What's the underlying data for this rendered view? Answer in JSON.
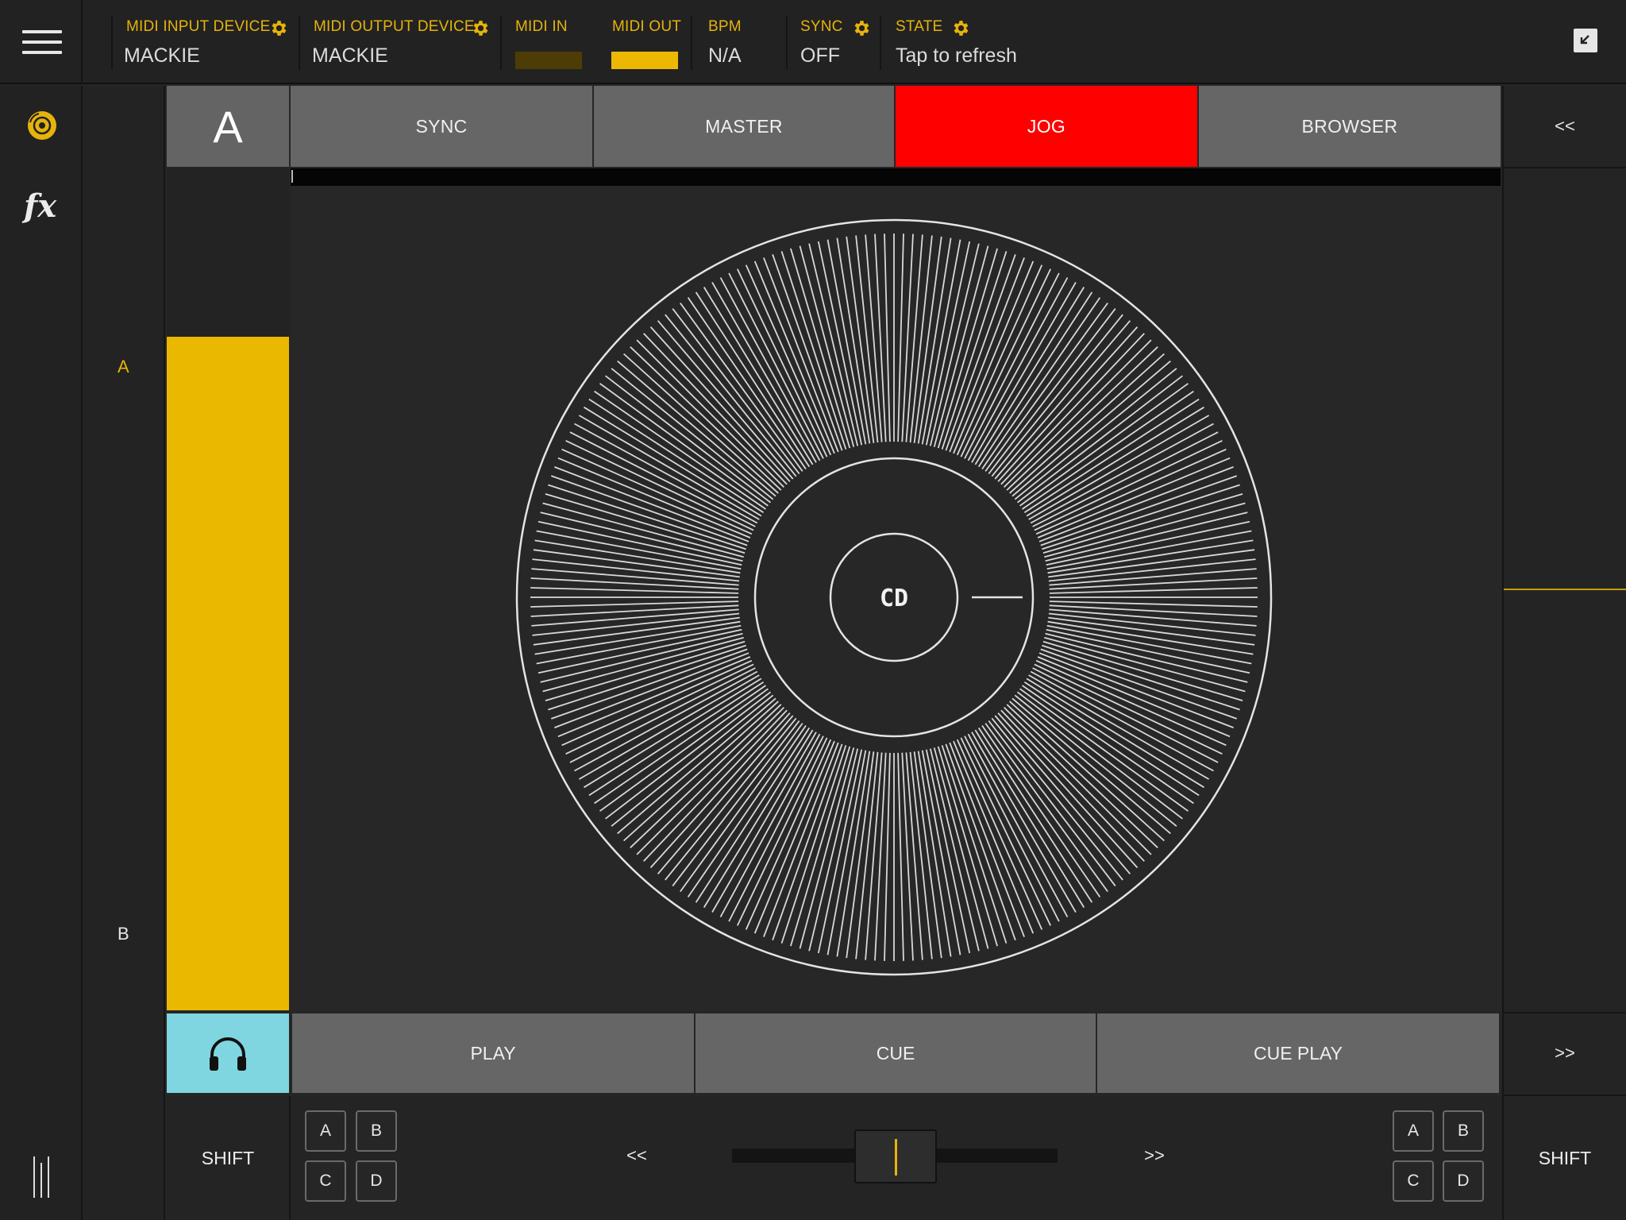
{
  "header": {
    "midi_input": {
      "label": "MIDI INPUT DEVICE",
      "value": "MACKIE"
    },
    "midi_output": {
      "label": "MIDI OUTPUT DEVICE",
      "value": "MACKIE"
    },
    "midi_in": {
      "label": "MIDI IN"
    },
    "midi_out": {
      "label": "MIDI OUT"
    },
    "bpm": {
      "label": "BPM",
      "value": "N/A"
    },
    "sync": {
      "label": "SYNC",
      "value": "OFF"
    },
    "state": {
      "label": "STATE",
      "value": "Tap to refresh"
    }
  },
  "nav": {
    "fx_label": "fx",
    "icons": [
      "menu-icon",
      "disc-icon",
      "fx-icon",
      "mixer-icon",
      "collapse-icon",
      "headphones-icon",
      "gear-icon"
    ]
  },
  "deck": {
    "letter": "A",
    "label_top": "A",
    "label_bottom": "B",
    "pitch_level_fraction": 0.8
  },
  "tabs": [
    {
      "label": "SYNC",
      "active": false
    },
    {
      "label": "MASTER",
      "active": false
    },
    {
      "label": "JOG",
      "active": true
    },
    {
      "label": "BROWSER",
      "active": false
    }
  ],
  "right": {
    "top_arrow": "<<",
    "bottom_arrow": ">>"
  },
  "jog": {
    "center_label": "CD"
  },
  "transport": {
    "play": "PLAY",
    "cue": "CUE",
    "cue_play": "CUE PLAY"
  },
  "bottom": {
    "shift_left": "SHIFT",
    "shift_right": "SHIFT",
    "left_keys": [
      "A",
      "B",
      "C",
      "D"
    ],
    "right_keys": [
      "A",
      "B",
      "C",
      "D"
    ],
    "nudge_back": "<<",
    "nudge_forward": ">>"
  },
  "colors": {
    "accent": "#edb804",
    "active_tab": "#ff0000",
    "headphone": "#7fd6e0",
    "button": "#666666",
    "background": "#262626"
  }
}
